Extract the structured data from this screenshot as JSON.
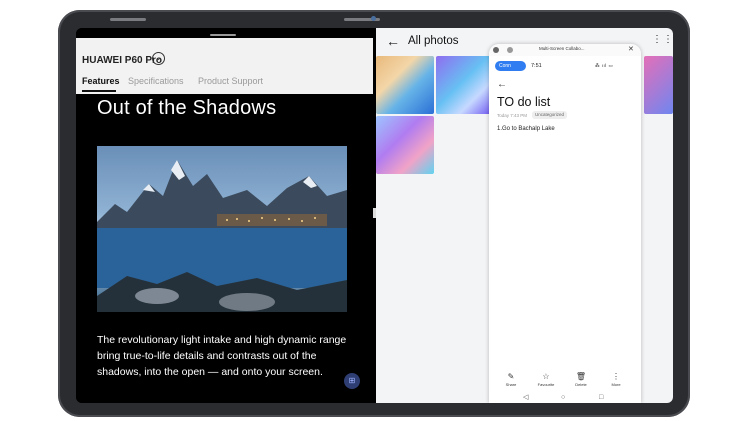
{
  "device": {
    "camera_color": "#4a6e9e"
  },
  "website": {
    "brand": "HUAWEI P60 Pro",
    "brand_chevron": "⌄",
    "tabs": [
      {
        "label": "Features",
        "active": true
      },
      {
        "label": "Specifications",
        "active": false
      },
      {
        "label": "Product Support",
        "active": false
      }
    ],
    "hero_title": "Out of the Shadows",
    "hero_body": "The revolutionary light intake and high dynamic range bring true-to-life details and contrasts out of the shadows, into the open — and onto your screen.",
    "float_icon": "grid-icon"
  },
  "gallery": {
    "back_icon": "←",
    "title": "All photos",
    "more_icon": "⋮⋮"
  },
  "phone_window": {
    "window_title": "Multi-Screen Collabo...",
    "connected_label": "Conn",
    "time": "7:51",
    "status_icons": "⁂ ııl ▭",
    "back_icon": "←",
    "heading": "TO do list",
    "meta_date": "Today 7:43 PM",
    "meta_category": "Uncategorized",
    "note_item": "1.Go to  Bachalp Lake",
    "toolbar": [
      {
        "icon": "✎",
        "label": "Share"
      },
      {
        "icon": "☆",
        "label": "Favourite"
      },
      {
        "icon": "🗑",
        "label": "Delete"
      },
      {
        "icon": "⋮",
        "label": "More"
      }
    ],
    "nav": {
      "back": "◁",
      "home": "○",
      "recent": "□"
    }
  }
}
